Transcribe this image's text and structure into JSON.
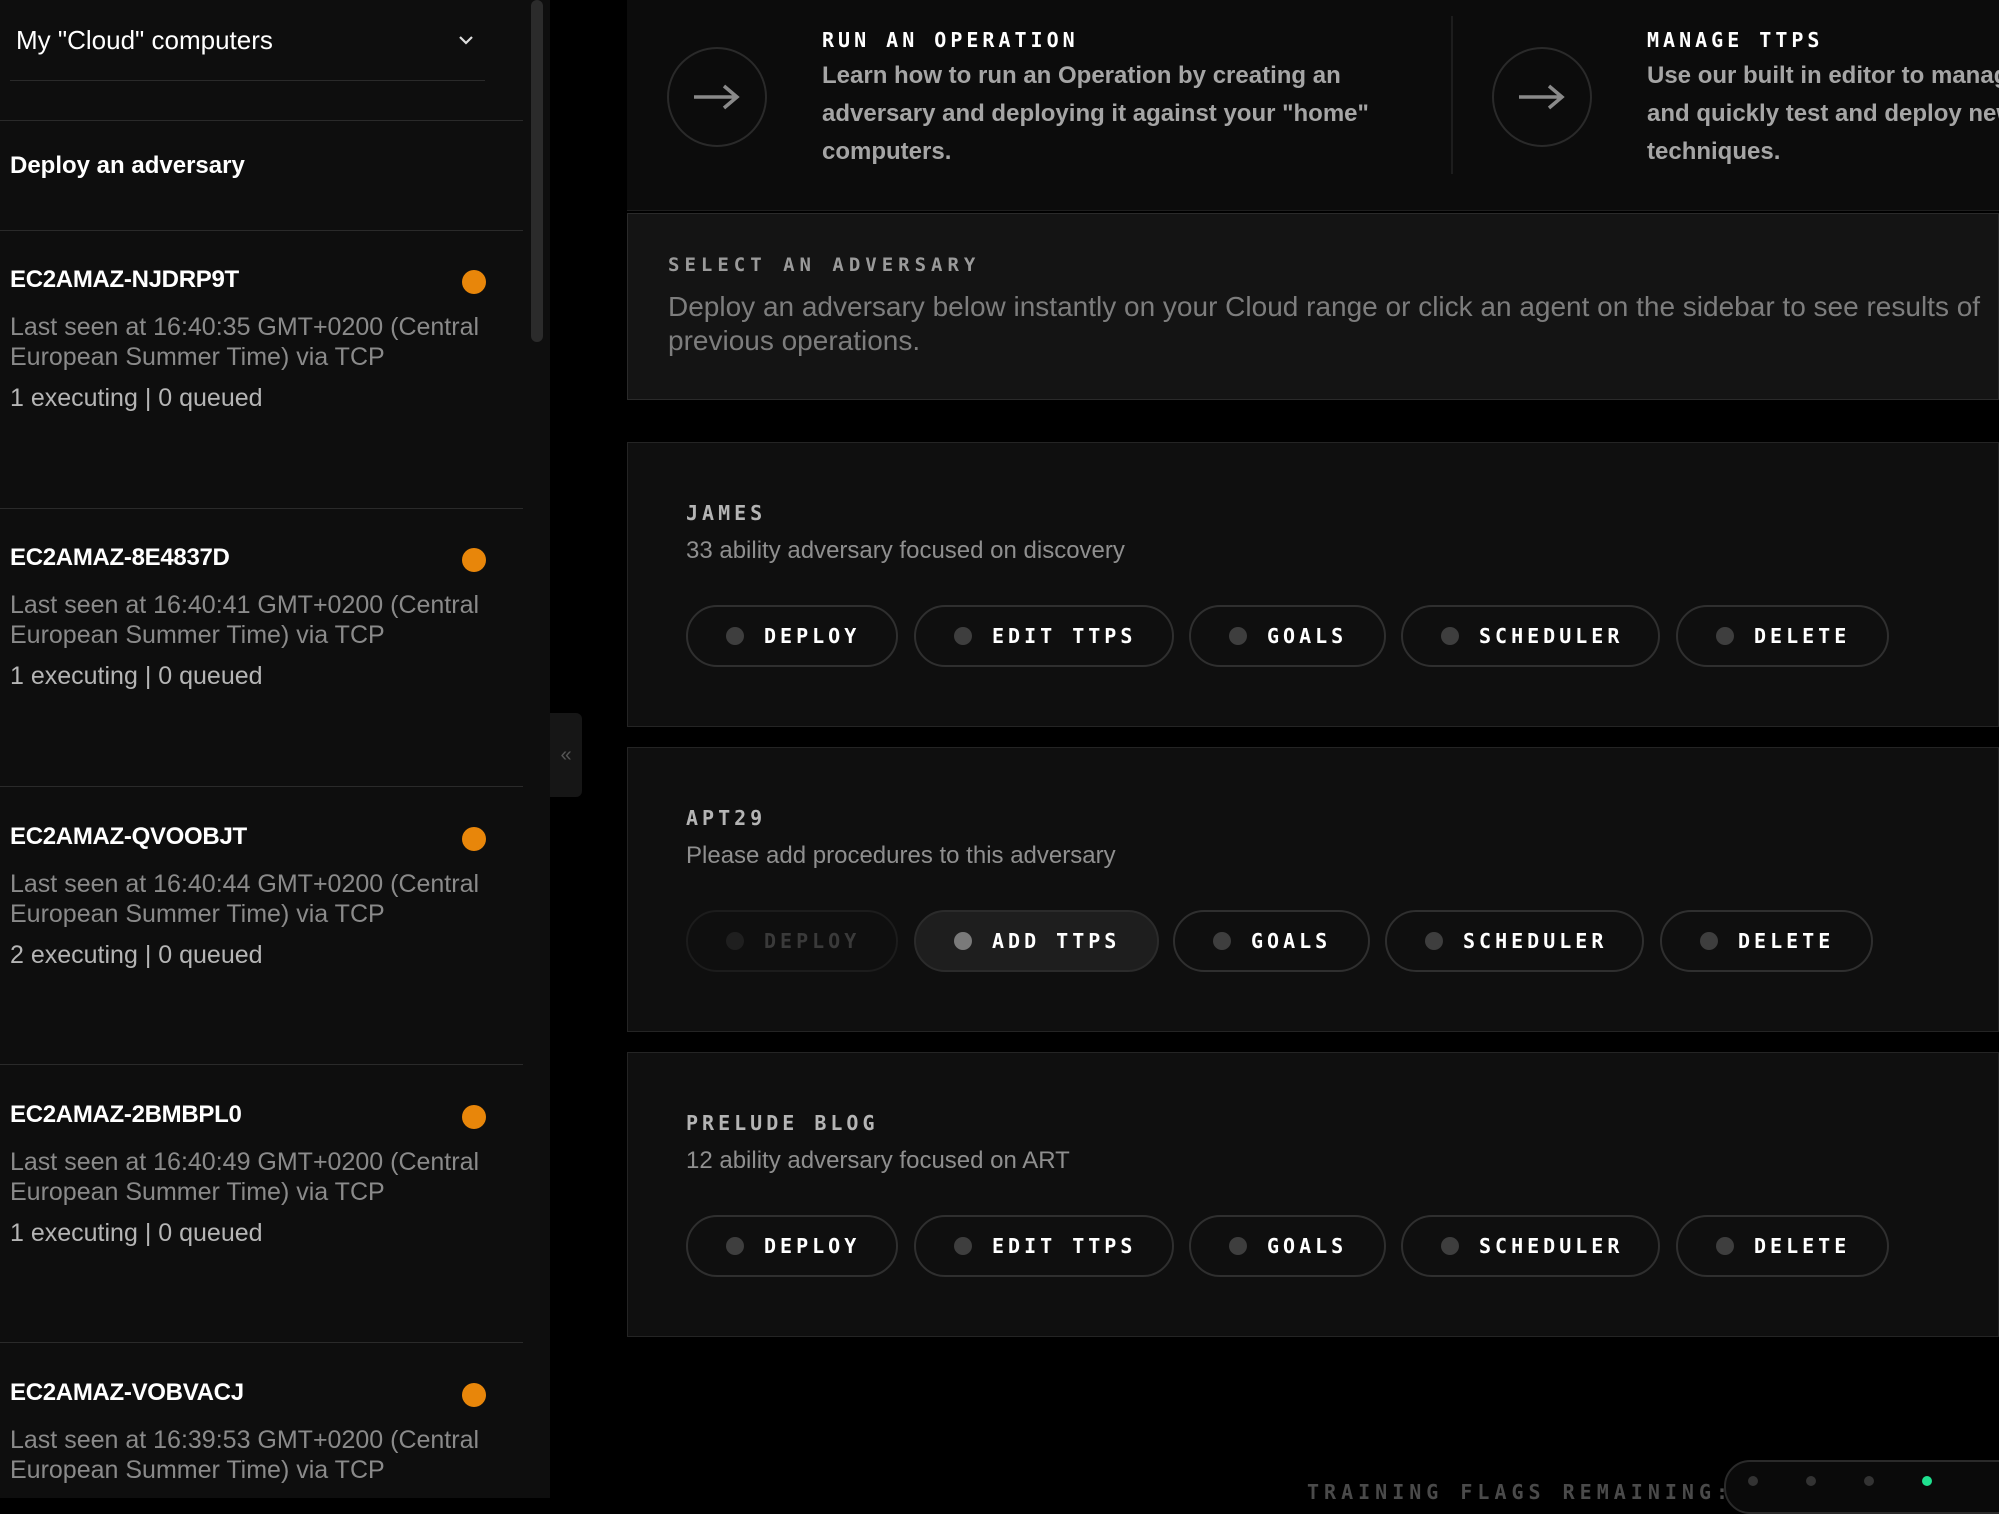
{
  "sidebar": {
    "range_selector": "My \"Cloud\" computers",
    "deploy_link": "Deploy an adversary",
    "status_color": "#e8860a",
    "agents": [
      {
        "name": "EC2AMAZ-NJDRP9T",
        "last_seen": "Last seen at 16:40:35 GMT+0200 (Central European Summer Time) via TCP",
        "counts": "1 executing | 0 queued"
      },
      {
        "name": "EC2AMAZ-8E4837D",
        "last_seen": "Last seen at 16:40:41 GMT+0200 (Central European Summer Time) via TCP",
        "counts": "1 executing | 0 queued"
      },
      {
        "name": "EC2AMAZ-QVOOBJT",
        "last_seen": "Last seen at 16:40:44 GMT+0200 (Central European Summer Time) via TCP",
        "counts": "2 executing | 0 queued"
      },
      {
        "name": "EC2AMAZ-2BMBPL0",
        "last_seen": "Last seen at 16:40:49 GMT+0200 (Central European Summer Time) via TCP",
        "counts": "1 executing | 0 queued"
      },
      {
        "name": "EC2AMAZ-VOBVACJ",
        "last_seen": "Last seen at 16:39:53 GMT+0200 (Central European Summer Time) via TCP",
        "counts": ""
      }
    ],
    "collapse_glyph": "«"
  },
  "top_panel": {
    "run_operation": {
      "title": "RUN AN OPERATION",
      "desc": "Learn how to run an Operation by creating an adversary and deploying it against your \"home\" computers."
    },
    "manage_ttps": {
      "title": "MANAGE TTPS",
      "desc": "Use our built in editor to manage and quickly test and deploy new techniques."
    }
  },
  "select_adversary": {
    "kicker": "SELECT AN ADVERSARY",
    "desc": "Deploy an adversary below instantly on your Cloud range or click an agent on the sidebar to see results of previous operations."
  },
  "adversaries": [
    {
      "name": "JAMES",
      "desc": "33 ability adversary focused on discovery",
      "buttons": [
        "DEPLOY",
        "EDIT TTPS",
        "GOALS",
        "SCHEDULER",
        "DELETE"
      ]
    },
    {
      "name": "APT29",
      "desc": "Please add procedures to this adversary",
      "buttons": [
        "DEPLOY",
        "ADD TTPS",
        "GOALS",
        "SCHEDULER",
        "DELETE"
      ]
    },
    {
      "name": "PRELUDE BLOG",
      "desc": "12 ability adversary focused on ART",
      "buttons": [
        "DEPLOY",
        "EDIT TTPS",
        "GOALS",
        "SCHEDULER",
        "DELETE"
      ]
    }
  ],
  "training_flags": {
    "label": "TRAINING FLAGS REMAINING:",
    "active_color": "#1fe08f"
  }
}
